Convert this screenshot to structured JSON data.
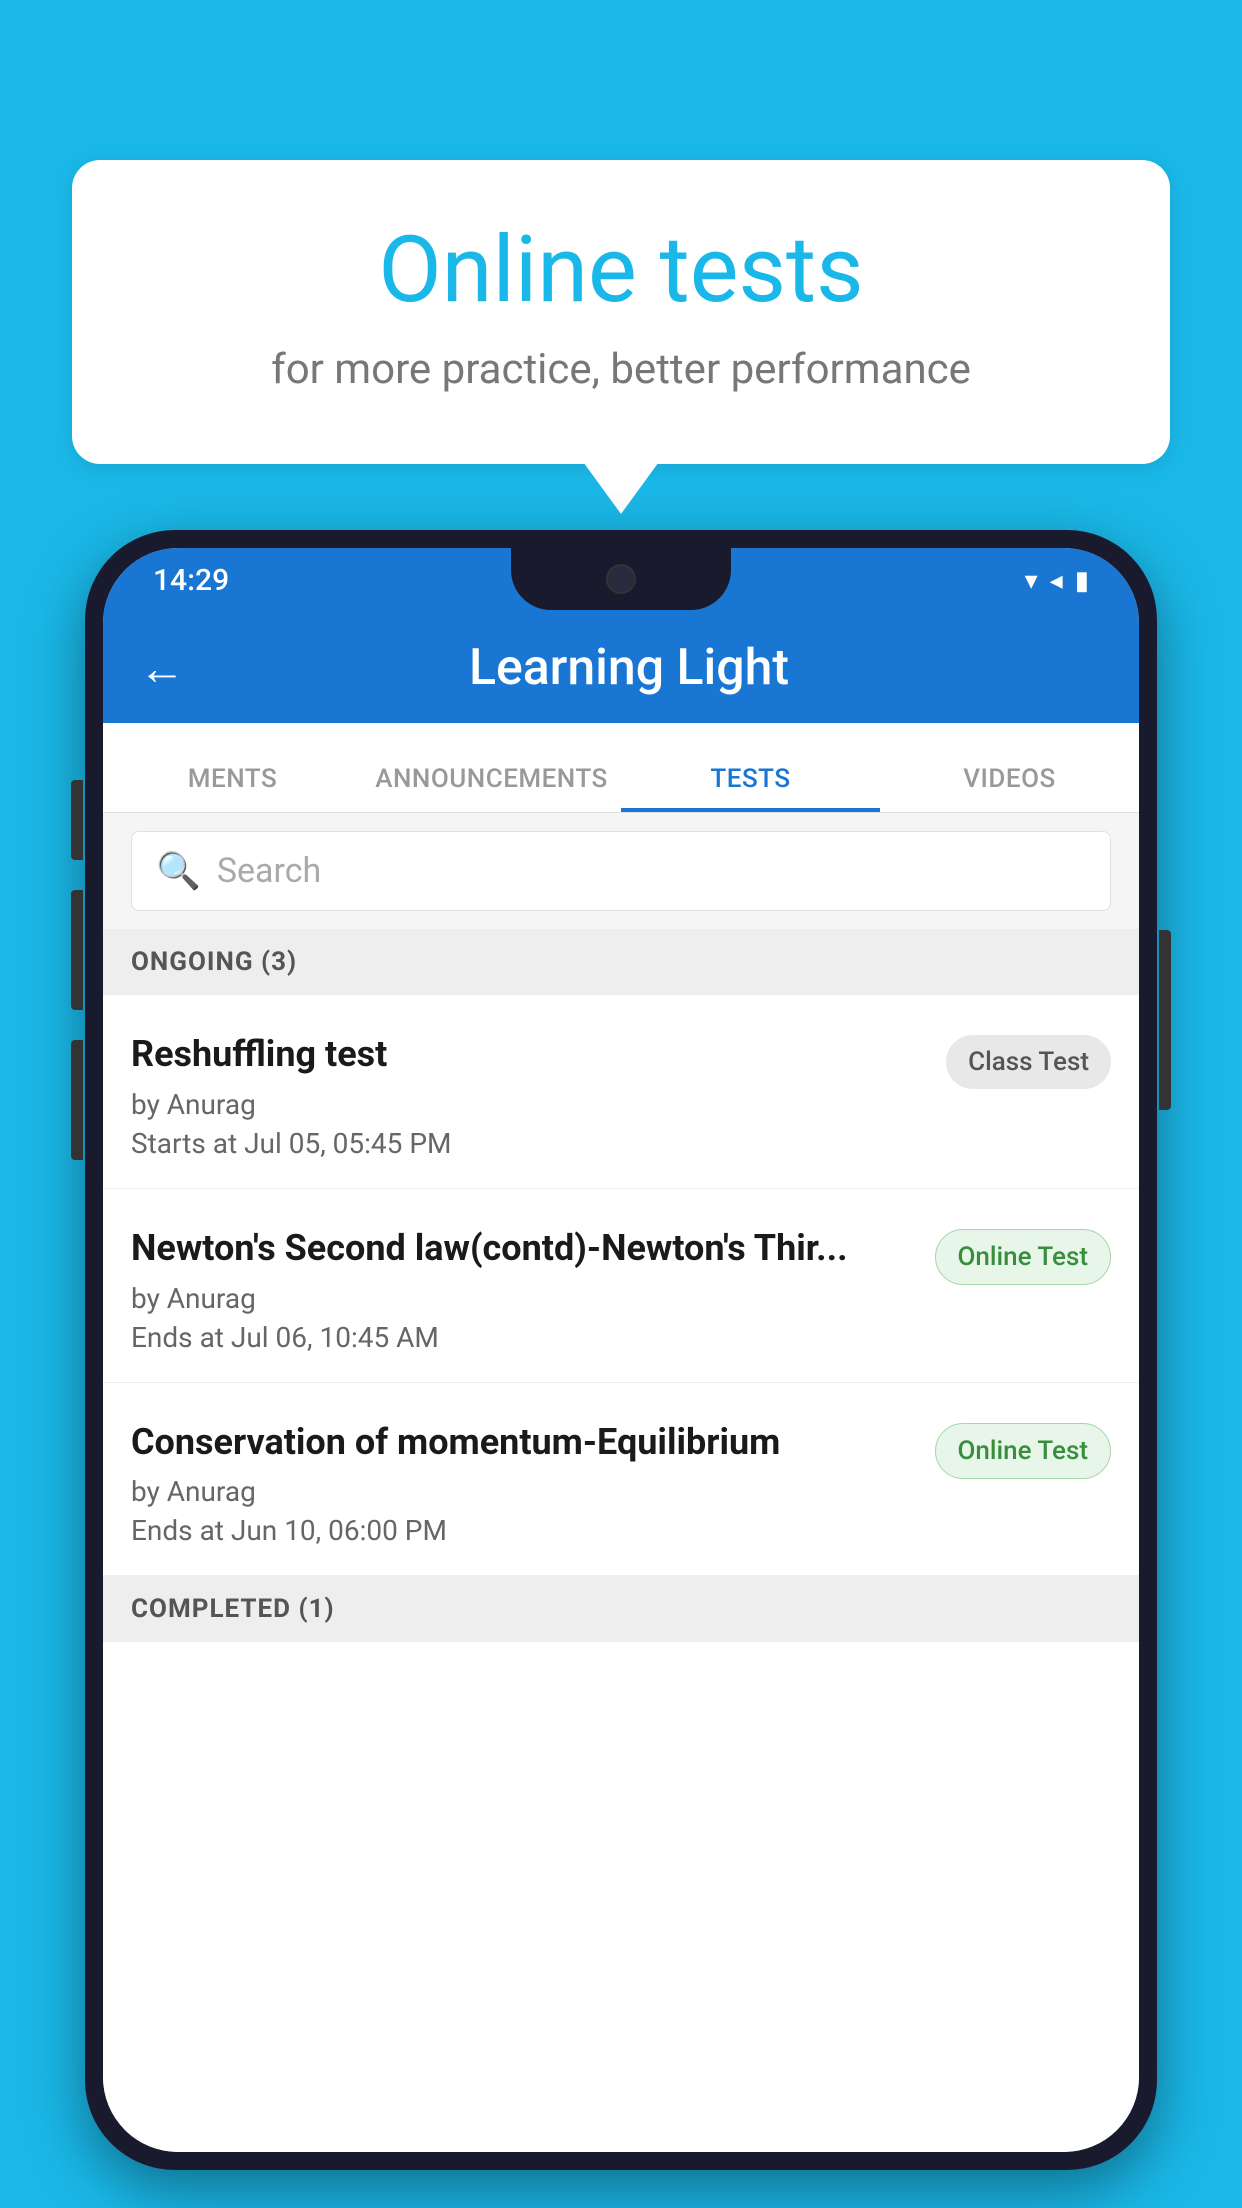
{
  "background_color": "#1ab8e8",
  "speech_bubble": {
    "title": "Online tests",
    "subtitle": "for more practice, better performance"
  },
  "status_bar": {
    "time": "14:29",
    "wifi": "▼",
    "signal": "▲",
    "battery": "▮"
  },
  "app_bar": {
    "back_icon": "←",
    "title": "Learning Light"
  },
  "tabs": [
    {
      "label": "MENTS",
      "active": false
    },
    {
      "label": "ANNOUNCEMENTS",
      "active": false
    },
    {
      "label": "TESTS",
      "active": true
    },
    {
      "label": "VIDEOS",
      "active": false
    }
  ],
  "search": {
    "placeholder": "Search",
    "icon": "🔍"
  },
  "ongoing_section": {
    "label": "ONGOING (3)"
  },
  "tests": [
    {
      "name": "Reshuffling test",
      "author": "by Anurag",
      "date": "Starts at  Jul 05, 05:45 PM",
      "badge": "Class Test",
      "badge_type": "class"
    },
    {
      "name": "Newton's Second law(contd)-Newton's Thir...",
      "author": "by Anurag",
      "date": "Ends at  Jul 06, 10:45 AM",
      "badge": "Online Test",
      "badge_type": "online"
    },
    {
      "name": "Conservation of momentum-Equilibrium",
      "author": "by Anurag",
      "date": "Ends at  Jun 10, 06:00 PM",
      "badge": "Online Test",
      "badge_type": "online"
    }
  ],
  "completed_section": {
    "label": "COMPLETED (1)"
  }
}
